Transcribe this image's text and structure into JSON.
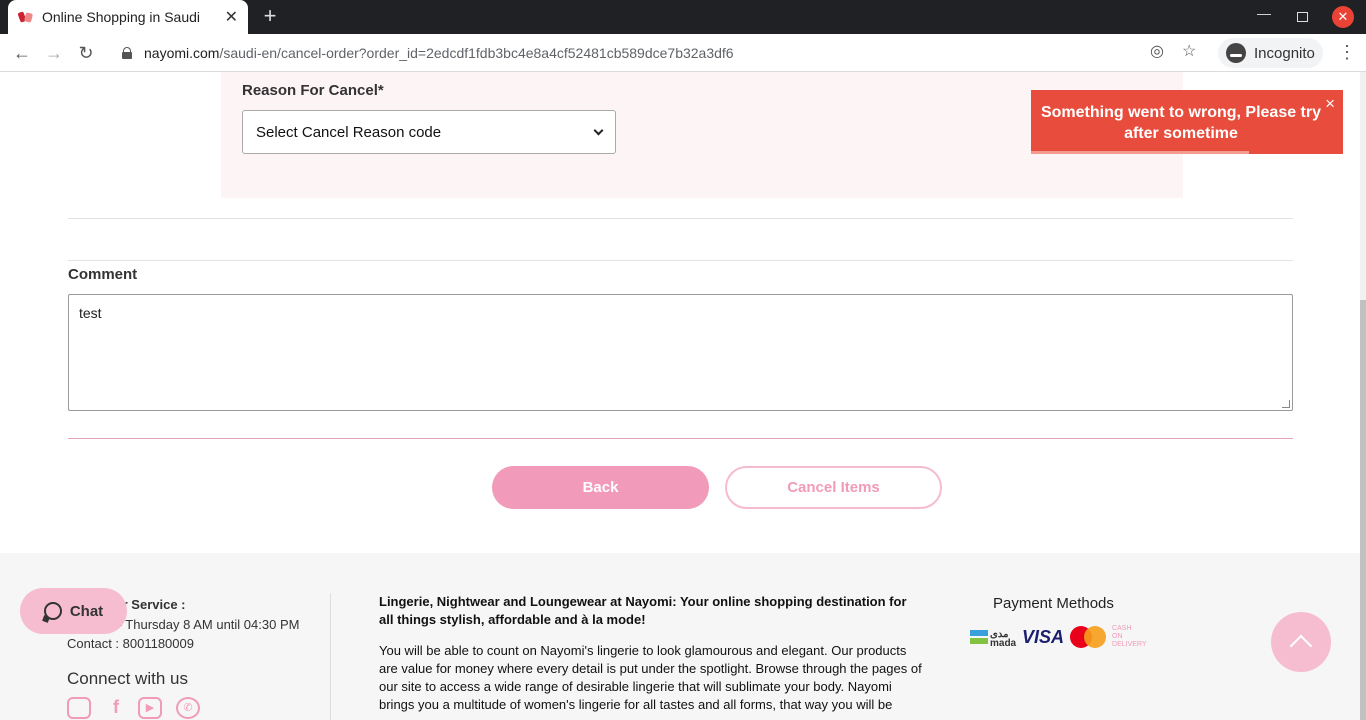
{
  "browser": {
    "tab_title": "Online Shopping in Saudi",
    "url_host": "nayomi.com",
    "url_path": "/saudi-en/cancel-order?order_id=2edcdf1fdb3bc4e8a4cf52481cb589dce7b32a3df6",
    "incognito_label": "Incognito"
  },
  "form": {
    "reason_label": "Reason For Cancel*",
    "reason_selected": "Select Cancel Reason code",
    "comment_label": "Comment",
    "comment_value": "test",
    "back_label": "Back",
    "cancel_label": "Cancel Items"
  },
  "toast": {
    "message": "Something went to wrong, Please try after sometime",
    "close": "×",
    "progress_fraction": 0.7
  },
  "footer": {
    "cs_title": "Customer Service :",
    "cs_hours": "Sunday – Thursday 8 AM until 04:30 PM",
    "cs_contact": "Contact : 8001180009",
    "connect": "Connect with us",
    "about_head": "Lingerie, Nightwear and Loungewear at Nayomi: Your online shopping destination for all things stylish, affordable and à la mode!",
    "about_body": "You will be able to count on Nayomi's lingerie to look glamourous and elegant. Our products are value for money where every detail is put under the spotlight. Browse through the pages of our site to access a wide range of desirable lingerie that will sublimate your body. Nayomi brings you a multitude of women's lingerie for all tastes and all forms, that way you will be",
    "payment_title": "Payment Methods",
    "payment": {
      "mada_en": "mada",
      "mada_ar": "مدى",
      "visa": "VISA",
      "mastercard": "MasterCard",
      "cod": "CASH ON DELIVERY"
    }
  },
  "chat": {
    "label": "Chat"
  },
  "colors": {
    "accent": "#f19aba",
    "toast": "#e74c3c",
    "panel": "#fdf4f6"
  }
}
